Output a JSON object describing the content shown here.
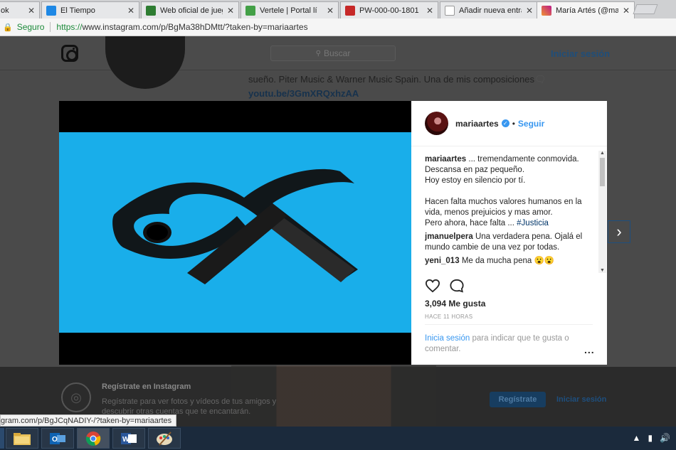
{
  "browser": {
    "tabs": [
      {
        "label": "ok",
        "color": "#3b5998",
        "active": false
      },
      {
        "label": "El Tiempo",
        "color": "#1e88e5",
        "active": false
      },
      {
        "label": "Web oficial de jueg",
        "color": "#2e7d32",
        "active": false
      },
      {
        "label": "Vertele | Portal lí",
        "color": "#43a047",
        "active": false
      },
      {
        "label": "PW-000-00-1801",
        "color": "#c62828",
        "active": false
      },
      {
        "label": "Añadir nueva entrad",
        "color": "#9e9e9e",
        "active": false
      },
      {
        "label": "María Artés (@mari",
        "color": "#c13584",
        "active": true
      }
    ],
    "secure_label": "Seguro",
    "url_protocol": "https://",
    "url_rest": "www.instagram.com/p/BgMa38hDMtt/?taken-by=mariaartes",
    "status_url": "gram.com/p/BgJCqNADIY-/?taken-by=mariaartes"
  },
  "ig": {
    "search_placeholder": "Buscar",
    "login_label": "Iniciar sesión",
    "bg_caption": "sueño. Piter Music & Warner Music Spain. Una de mis composiciones",
    "bg_link": "youtu.be/3GmXRQxhzAA"
  },
  "post": {
    "username": "mariaartes",
    "follow_label": "Seguir",
    "caption_user": "mariaartes",
    "caption_lines": [
      "... tremendamente conmovida.",
      "Descansa en paz pequeño.",
      "Hoy estoy en silencio por tí.",
      "",
      "Hacen falta muchos valores humanos en la vida, menos prejuicios y mas amor.",
      "Pero ahora, hace falta ..."
    ],
    "hashtag": "#Justicia",
    "comments": [
      {
        "user": "jmanuelpera",
        "text": "Una verdadera pena. Ojalá el mundo cambie de una vez por todas."
      },
      {
        "user": "yeni_013",
        "text": "Me da mucha pena 😮😮"
      }
    ],
    "likes": "3,094 Me gusta",
    "time": "HACE 11 HORAS",
    "login_link": "Inicia sesión",
    "login_text": " para indicar que te gusta o comentar.",
    "more": "..."
  },
  "banner": {
    "title": "Regístrate en Instagram",
    "subtitle": "Regístrate para ver fotos y vídeos de tus amigos y descubrir otras cuentas que te encantarán.",
    "signup_button": "Regístrate",
    "login_link": "Iniciar sesión"
  },
  "colors": {
    "media_background": "#19aeea",
    "ribbon": "#111111",
    "accent": "#3897f0"
  }
}
